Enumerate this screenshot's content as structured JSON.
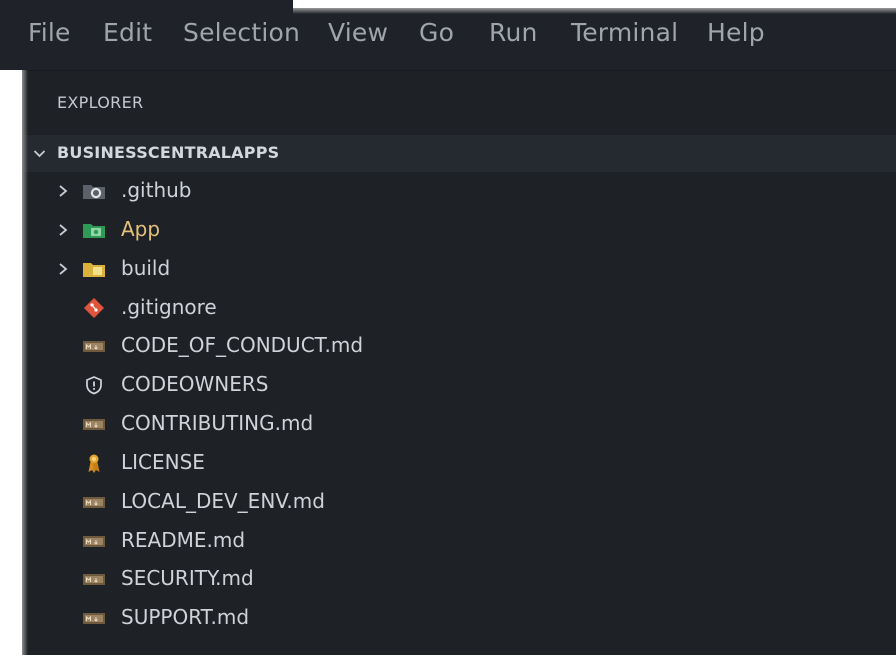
{
  "menubar": {
    "items": [
      "File",
      "Edit",
      "Selection",
      "View",
      "Go",
      "Run",
      "Terminal",
      "Help"
    ]
  },
  "explorer": {
    "title": "EXPLORER",
    "section": "BUSINESSCENTRALAPPS",
    "items": [
      {
        "label": ".github",
        "kind": "folder",
        "icon": "github-folder-icon"
      },
      {
        "label": "App",
        "kind": "folder",
        "icon": "app-folder-icon",
        "color": "#e3c17b"
      },
      {
        "label": "build",
        "kind": "folder",
        "icon": "build-folder-icon"
      },
      {
        "label": ".gitignore",
        "kind": "file",
        "icon": "git-icon"
      },
      {
        "label": "CODE_OF_CONDUCT.md",
        "kind": "file",
        "icon": "markdown-icon"
      },
      {
        "label": "CODEOWNERS",
        "kind": "file",
        "icon": "shield-icon"
      },
      {
        "label": "CONTRIBUTING.md",
        "kind": "file",
        "icon": "markdown-icon"
      },
      {
        "label": "LICENSE",
        "kind": "file",
        "icon": "license-icon"
      },
      {
        "label": "LOCAL_DEV_ENV.md",
        "kind": "file",
        "icon": "markdown-icon"
      },
      {
        "label": "README.md",
        "kind": "file",
        "icon": "markdown-icon"
      },
      {
        "label": "SECURITY.md",
        "kind": "file",
        "icon": "markdown-icon"
      },
      {
        "label": "SUPPORT.md",
        "kind": "file",
        "icon": "markdown-icon"
      }
    ]
  },
  "colors": {
    "background": "#1e2227",
    "menu_text": "#9fa4ad",
    "folder_highlight": "#e3c17b"
  }
}
